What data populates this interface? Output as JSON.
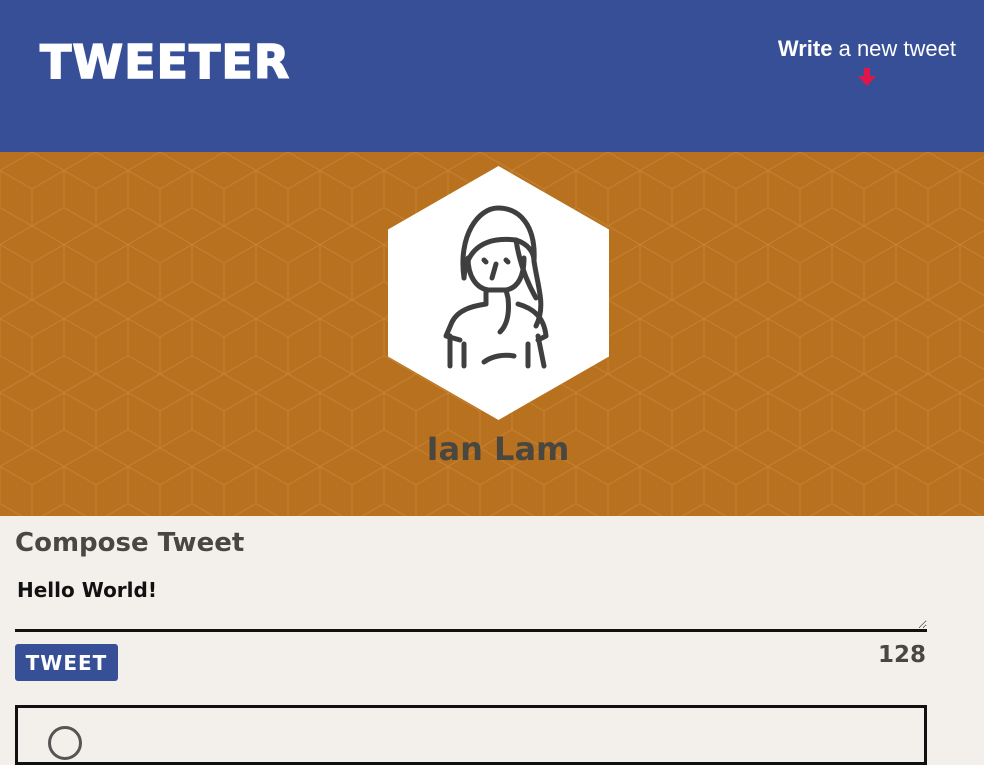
{
  "app": {
    "brand": "Tweeter"
  },
  "nav": {
    "write_bold": "Write",
    "write_rest": " a new tweet",
    "arrow_icon": "arrow-down-icon",
    "arrow_color": "#e0164a"
  },
  "profile": {
    "name": "Ian Lam",
    "avatar_icon": "user-avatar-icon",
    "banner_color": "#b8711f"
  },
  "compose": {
    "title": "Compose Tweet",
    "text": "Hello World!",
    "button_label": "Tweet",
    "counter": "128"
  },
  "colors": {
    "nav_bg": "#374f96",
    "page_bg": "#f3efea",
    "text_dark": "#4a4640"
  }
}
